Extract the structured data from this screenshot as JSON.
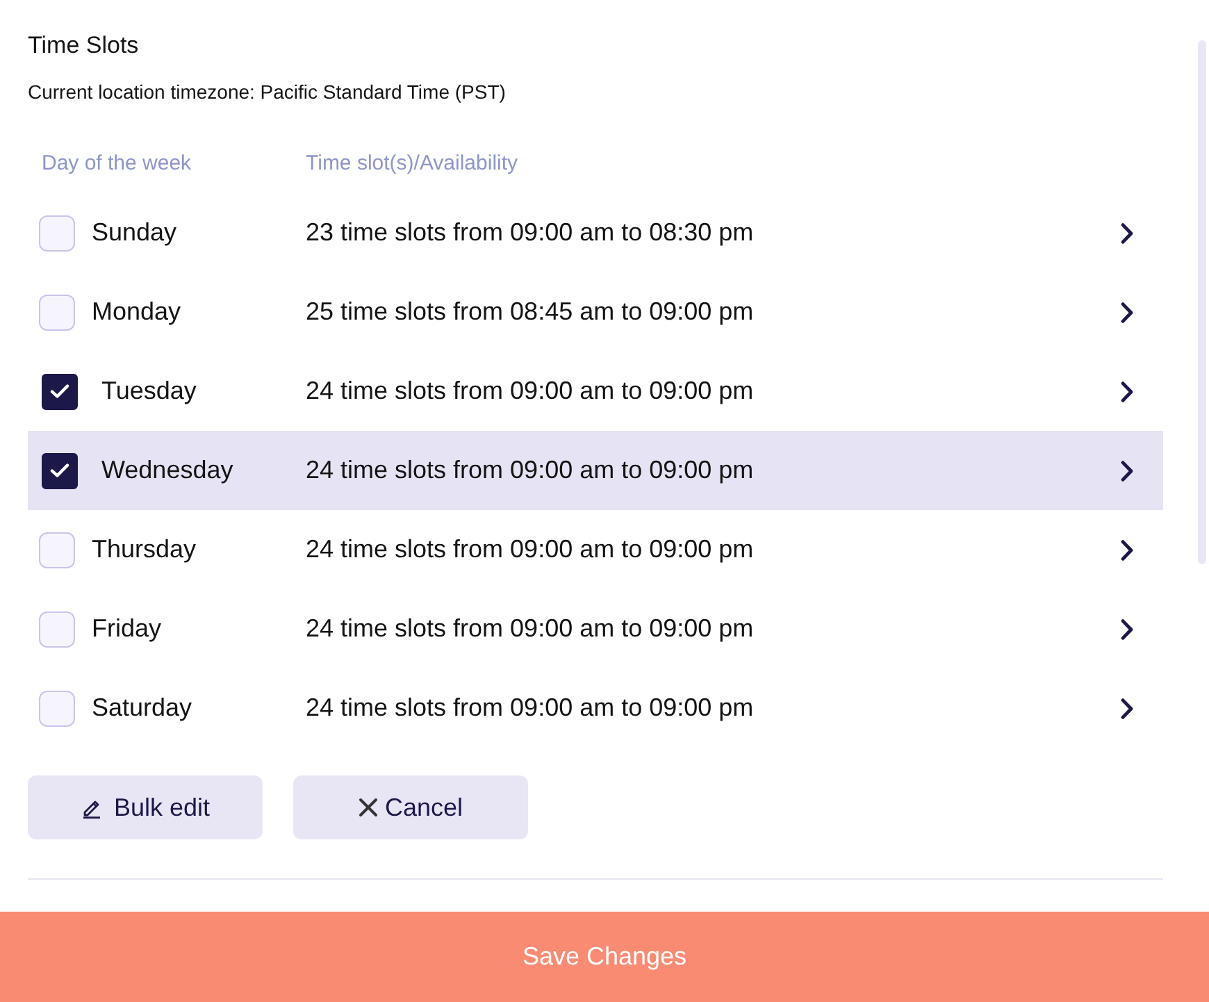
{
  "title": "Time Slots",
  "timezone_note": "Current location timezone: Pacific Standard Time (PST)",
  "table": {
    "columns": [
      "Day of the week",
      "Time slot(s)/Availability"
    ],
    "rows": [
      {
        "day": "Sunday",
        "availability": "23 time slots from 09:00 am to 08:30 pm",
        "checked": false,
        "selected": false
      },
      {
        "day": "Monday",
        "availability": "25 time slots from 08:45 am to 09:00 pm",
        "checked": false,
        "selected": false
      },
      {
        "day": "Tuesday",
        "availability": "24 time slots from 09:00 am to 09:00 pm",
        "checked": true,
        "selected": false
      },
      {
        "day": "Wednesday",
        "availability": "24 time slots from 09:00 am to 09:00 pm",
        "checked": true,
        "selected": true
      },
      {
        "day": "Thursday",
        "availability": "24 time slots from 09:00 am to 09:00 pm",
        "checked": false,
        "selected": false
      },
      {
        "day": "Friday",
        "availability": "24 time slots from 09:00 am to 09:00 pm",
        "checked": false,
        "selected": false
      },
      {
        "day": "Saturday",
        "availability": "24 time slots from 09:00 am to 09:00 pm",
        "checked": false,
        "selected": false
      }
    ]
  },
  "buttons": [
    {
      "kind": "edit",
      "label": "Bulk edit"
    },
    {
      "kind": "cancel",
      "label": "Cancel"
    }
  ],
  "save_button": {
    "label": "Save Changes"
  }
}
